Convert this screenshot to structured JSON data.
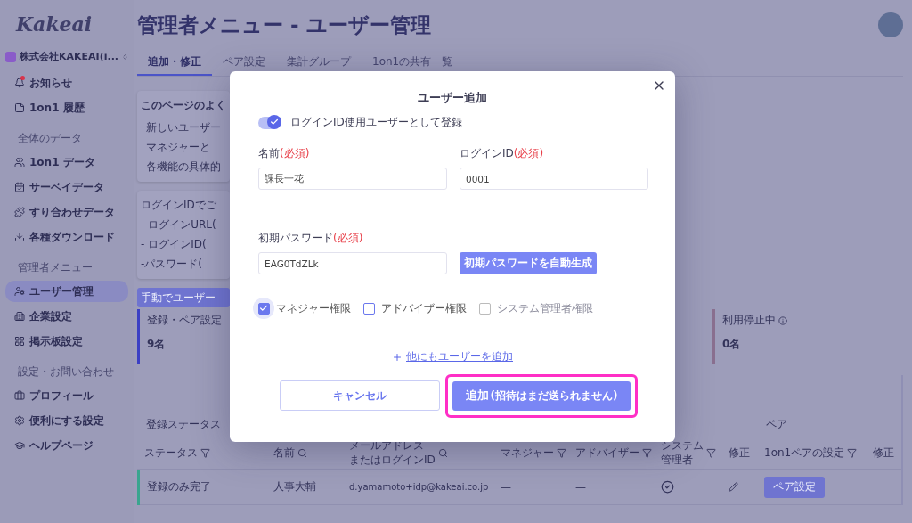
{
  "sidebar": {
    "logo": "Kakeai",
    "company": "株式会社KAKEAI(i...",
    "sections": [
      {
        "items": [
          {
            "label": "お知らせ",
            "selected": false,
            "unread": true
          },
          {
            "label": "1on1 履歴",
            "selected": false,
            "unread": false
          }
        ]
      },
      {
        "heading": "全体のデータ",
        "items": [
          {
            "label": "1on1 データ",
            "selected": false,
            "unread": false
          },
          {
            "label": "サーベイデータ",
            "selected": false,
            "unread": false
          },
          {
            "label": "すり合わせデータ",
            "selected": false,
            "unread": false
          },
          {
            "label": "各種ダウンロード",
            "selected": false,
            "unread": false
          }
        ]
      },
      {
        "heading": "管理者メニュー",
        "items": [
          {
            "label": "ユーザー管理",
            "selected": true,
            "unread": false
          },
          {
            "label": "企業設定",
            "selected": false,
            "unread": false
          },
          {
            "label": "掲示板設定",
            "selected": false,
            "unread": false
          }
        ]
      },
      {
        "heading": "設定・お問い合わせ",
        "items": [
          {
            "label": "プロフィール",
            "selected": false,
            "unread": false
          },
          {
            "label": "便利にする設定",
            "selected": false,
            "unread": false
          },
          {
            "label": "ヘルプページ",
            "selected": false,
            "unread": false
          }
        ]
      }
    ]
  },
  "page": {
    "title": "管理者メニュー - ユーザー管理",
    "tabs": [
      {
        "label": "追加・修正",
        "selected": true
      },
      {
        "label": "ペア設定",
        "selected": false
      },
      {
        "label": "集計グループ",
        "selected": false
      },
      {
        "label": "1on1の共有一覧",
        "selected": false
      }
    ],
    "faq": {
      "title": "このページのよく",
      "lines": [
        "新しいユーザー",
        "マネジャーと",
        "各機能の具体的"
      ]
    },
    "login_info": [
      "ログインIDでご",
      "- ログインURL(",
      "- ログインID(",
      "-パスワード("
    ],
    "manual_add_button": "手動でユーザー",
    "stats": [
      {
        "label": "登録・ペア設定",
        "count": "9名",
        "color": "#3b3fc4"
      },
      {
        "label": "利用停止中",
        "count": "0名",
        "color": "#8a7090"
      }
    ],
    "table": {
      "group_headers": [
        "登録ステータス",
        "ペア"
      ],
      "columns": [
        {
          "lines": [
            "ステータス"
          ]
        },
        {
          "lines": [
            "名前"
          ]
        },
        {
          "lines": [
            "メールアドレス",
            "またはログインID"
          ]
        },
        {
          "lines": [
            "マネジャー"
          ]
        },
        {
          "lines": [
            "アドバイザー"
          ]
        },
        {
          "lines": [
            "システム",
            "管理者"
          ]
        },
        {
          "lines": [
            "修正"
          ]
        },
        {
          "lines": [
            "1on1ペアの設定"
          ]
        },
        {
          "lines": [
            "修正"
          ]
        }
      ],
      "rows": [
        {
          "status": "登録のみ完了",
          "color": "#3aa58f",
          "name": "人事大輔",
          "email": "d.yamamoto+idp@kakeai.co.jp",
          "manager": "—",
          "advisor": "—",
          "admin": true,
          "pair_button": "ペア設定"
        }
      ]
    }
  },
  "dialog": {
    "title": "ユーザー追加",
    "toggle": {
      "label": "ログインID使用ユーザーとして登録",
      "on": true
    },
    "fields": [
      {
        "label": "名前",
        "required": "(必須)",
        "value": "課長一花"
      },
      {
        "label": "ログインID",
        "required": "(必須)",
        "value": "0001"
      },
      {
        "label": "初期パスワード",
        "required": "(必須)",
        "value": "EAG0TdZLk"
      }
    ],
    "generate_button": "初期パスワードを自動生成",
    "roles": [
      {
        "label": "マネジャー権限",
        "checked": true,
        "disabled": false
      },
      {
        "label": "アドバイザー権限",
        "checked": false,
        "disabled": false
      },
      {
        "label": "システム管理者権限",
        "checked": false,
        "disabled": true
      }
    ],
    "add_more": "他にもユーザーを追加",
    "cancel": "キャンセル",
    "submit": {
      "label": "追加",
      "note": "(招待はまだ送られません)",
      "highlighted": true
    }
  }
}
